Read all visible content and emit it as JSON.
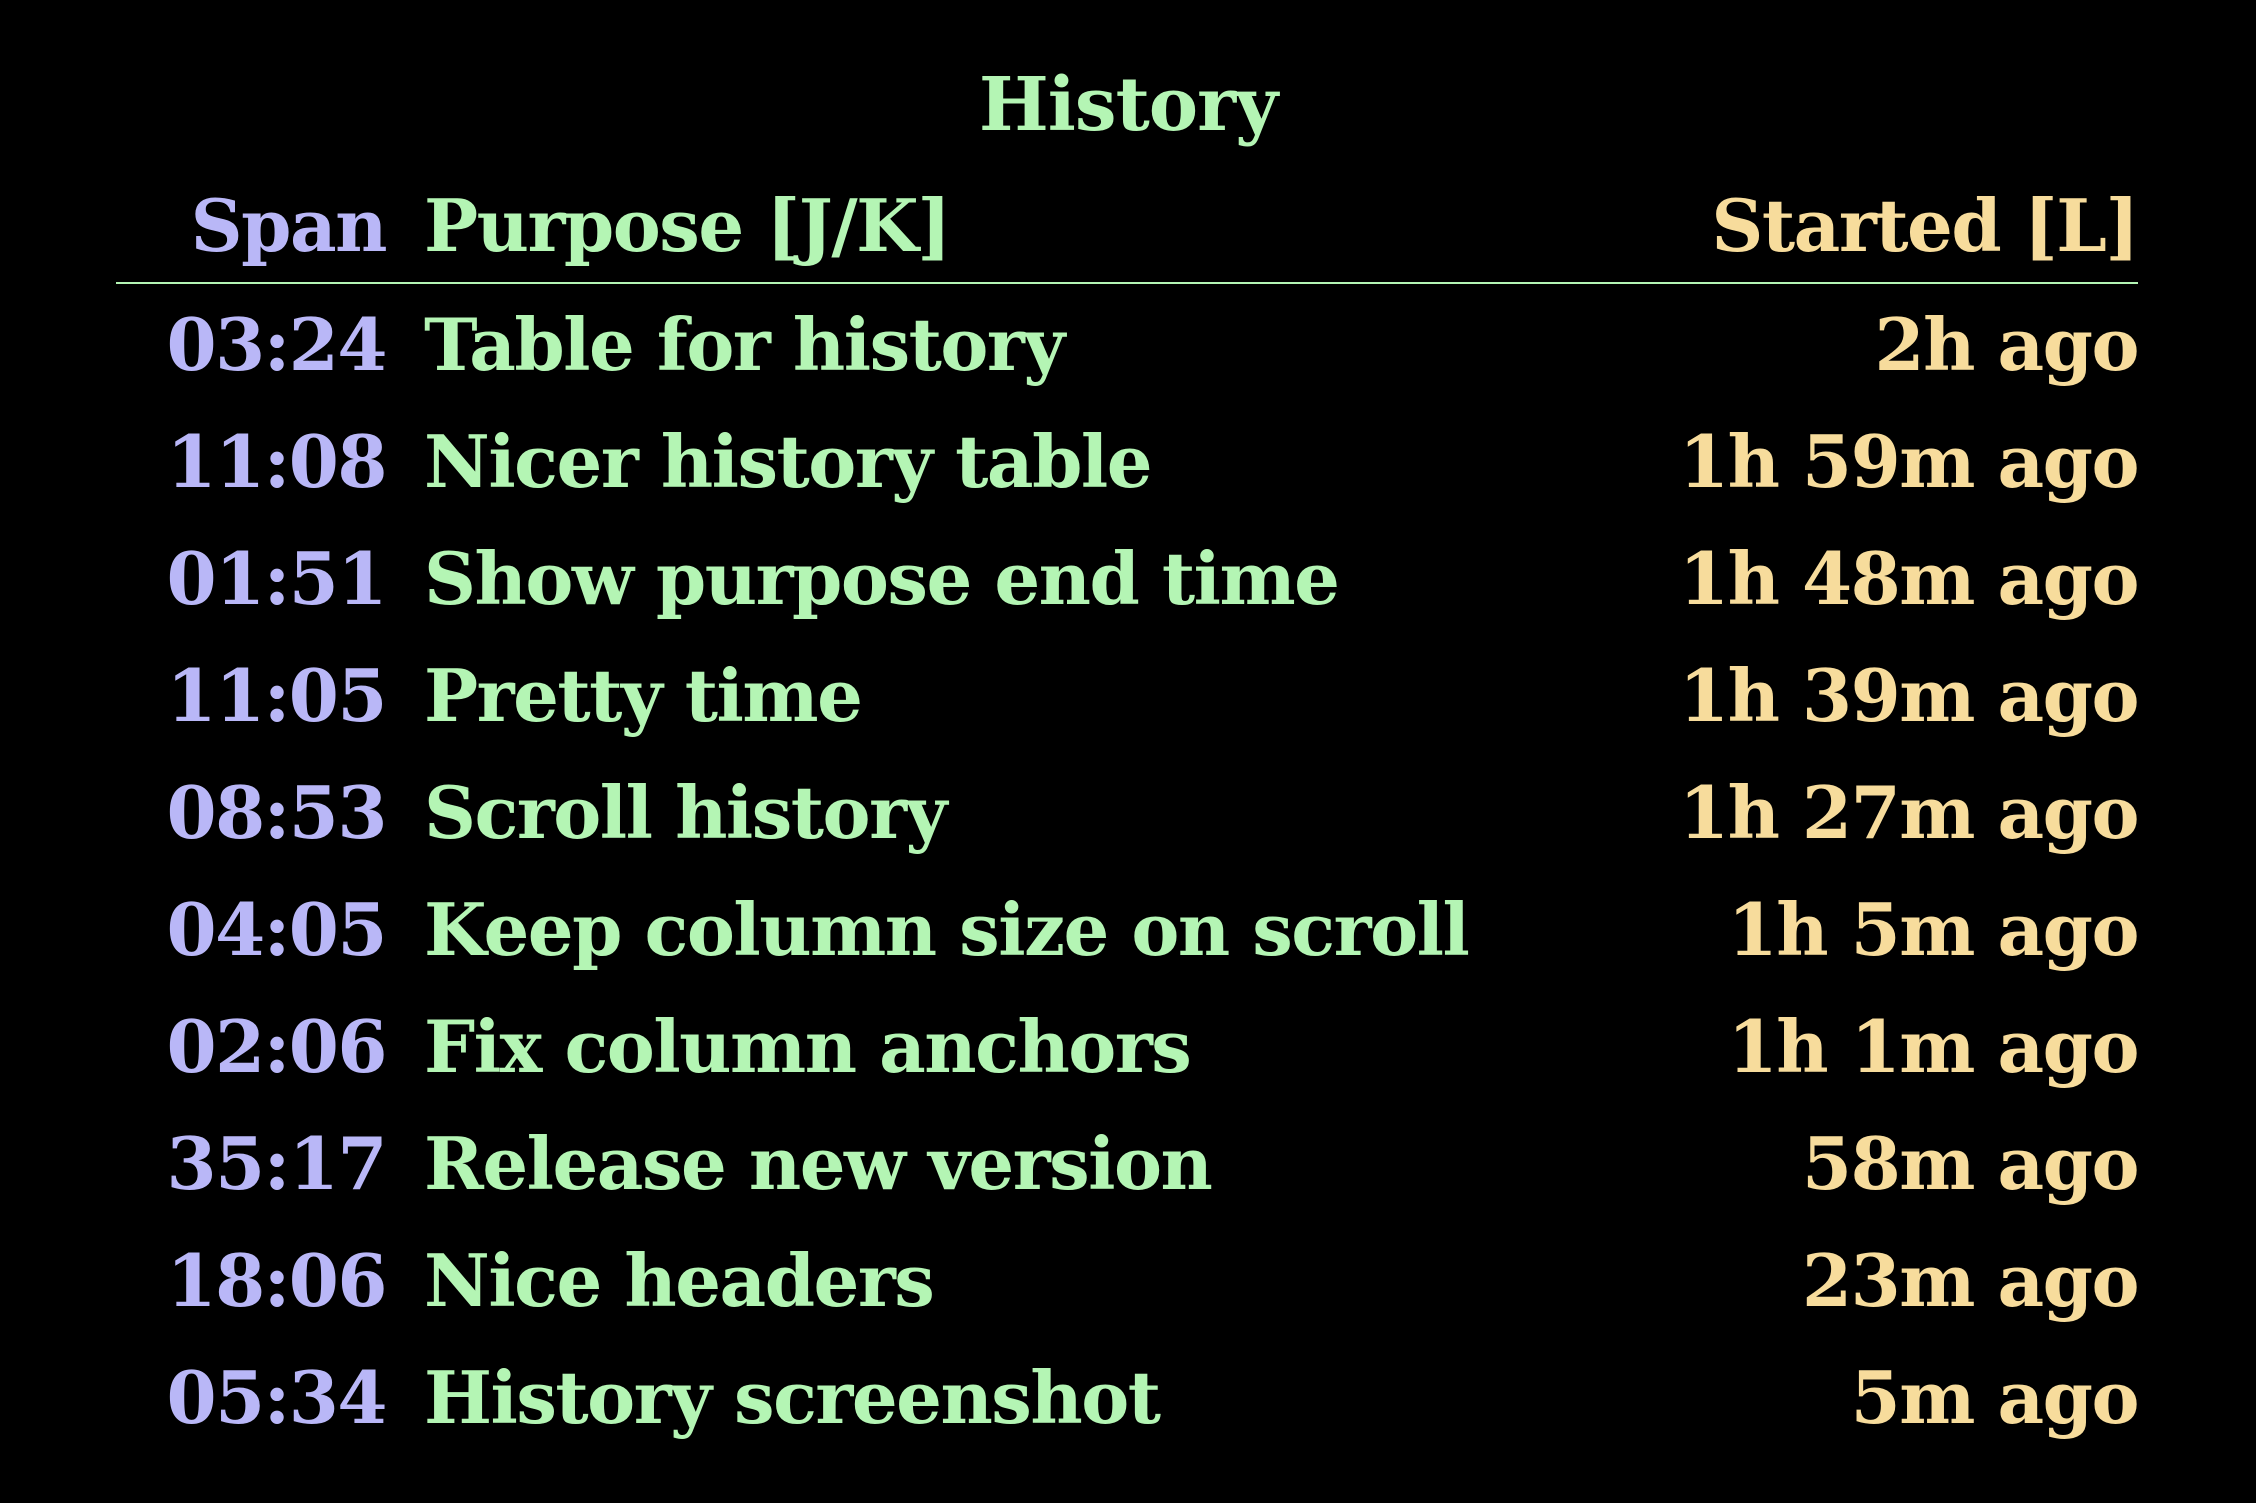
{
  "title": "History",
  "columns": {
    "span": "Span",
    "purpose": "Purpose [J/K]",
    "started": "Started [L]"
  },
  "colors": {
    "background": "#000000",
    "span": "#b9b7f7",
    "purpose": "#b4f5b4",
    "started": "#f7dc9c",
    "divider": "#b4f5b4"
  },
  "rows": [
    {
      "span": "03:24",
      "purpose": "Table for history",
      "started": "2h ago"
    },
    {
      "span": "11:08",
      "purpose": "Nicer history table",
      "started": "1h 59m ago"
    },
    {
      "span": "01:51",
      "purpose": "Show purpose end time",
      "started": "1h 48m ago"
    },
    {
      "span": "11:05",
      "purpose": "Pretty time",
      "started": "1h 39m ago"
    },
    {
      "span": "08:53",
      "purpose": "Scroll history",
      "started": "1h 27m ago"
    },
    {
      "span": "04:05",
      "purpose": "Keep column size on scroll",
      "started": "1h 5m ago"
    },
    {
      "span": "02:06",
      "purpose": "Fix column anchors",
      "started": "1h 1m ago"
    },
    {
      "span": "35:17",
      "purpose": "Release new version",
      "started": "58m ago"
    },
    {
      "span": "18:06",
      "purpose": "Nice headers",
      "started": "23m ago"
    },
    {
      "span": "05:34",
      "purpose": "History screenshot",
      "started": "5m ago"
    }
  ]
}
